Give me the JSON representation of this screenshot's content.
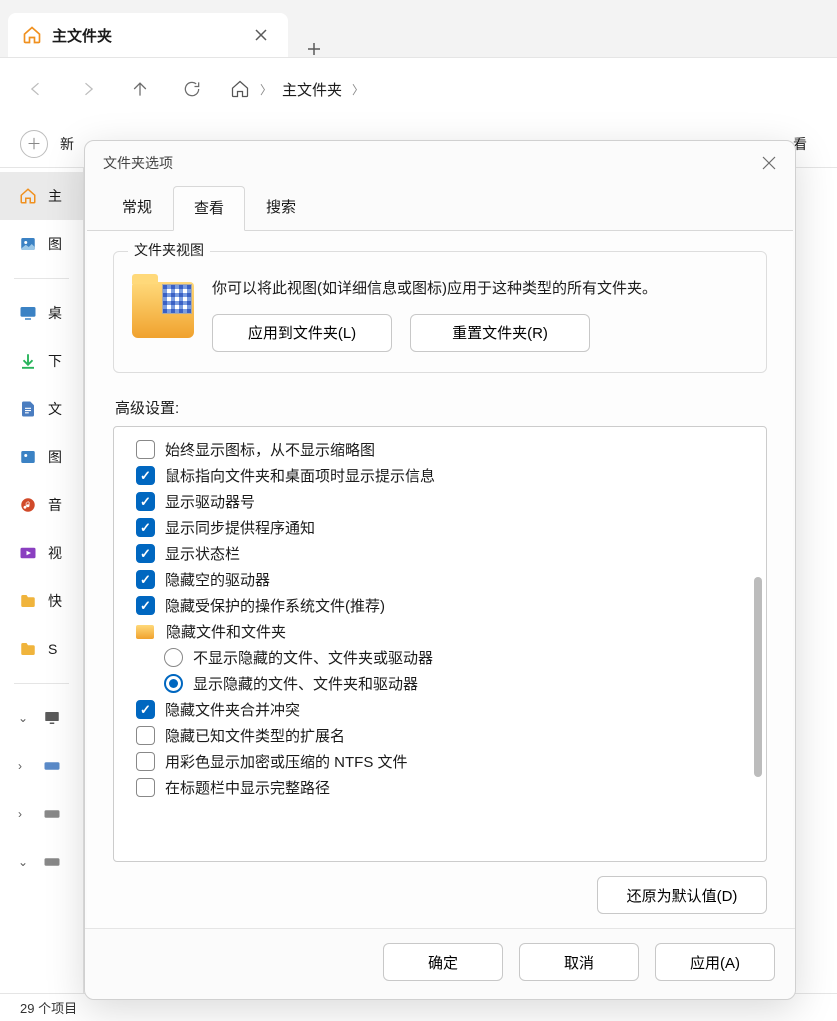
{
  "tab": {
    "title": "主文件夹"
  },
  "newButtonLabel": "新",
  "viewLabel": "看",
  "breadcrumb": {
    "item": "主文件夹"
  },
  "sidebar": {
    "items": [
      {
        "name": "home",
        "label": "主"
      },
      {
        "name": "images",
        "label": "图"
      },
      {
        "name": "desktop",
        "label": "桌"
      },
      {
        "name": "downloads",
        "label": "下"
      },
      {
        "name": "documents",
        "label": "文"
      },
      {
        "name": "pictures",
        "label": "图"
      },
      {
        "name": "music",
        "label": "音"
      },
      {
        "name": "videos",
        "label": "视"
      },
      {
        "name": "shortcut1",
        "label": "快"
      },
      {
        "name": "shortcut2",
        "label": "S"
      }
    ]
  },
  "statusbar": "29 个项目",
  "dialog": {
    "title": "文件夹选项",
    "tabs": {
      "general": "常规",
      "view": "查看",
      "search": "搜索"
    },
    "group": {
      "legend": "文件夹视图",
      "text": "你可以将此视图(如详细信息或图标)应用于这种类型的所有文件夹。",
      "applyBtn": "应用到文件夹(L)",
      "resetBtn": "重置文件夹(R)"
    },
    "advLabel": "高级设置:",
    "options": [
      {
        "type": "check",
        "checked": false,
        "label": "始终显示图标，从不显示缩略图"
      },
      {
        "type": "check",
        "checked": true,
        "label": "鼠标指向文件夹和桌面项时显示提示信息"
      },
      {
        "type": "check",
        "checked": true,
        "label": "显示驱动器号"
      },
      {
        "type": "check",
        "checked": true,
        "label": "显示同步提供程序通知"
      },
      {
        "type": "check",
        "checked": true,
        "label": "显示状态栏"
      },
      {
        "type": "check",
        "checked": true,
        "label": "隐藏空的驱动器"
      },
      {
        "type": "check",
        "checked": true,
        "label": "隐藏受保护的操作系统文件(推荐)"
      },
      {
        "type": "folder",
        "label": "隐藏文件和文件夹"
      },
      {
        "type": "radio",
        "checked": false,
        "indent": true,
        "label": "不显示隐藏的文件、文件夹或驱动器"
      },
      {
        "type": "radio",
        "checked": true,
        "indent": true,
        "label": "显示隐藏的文件、文件夹和驱动器"
      },
      {
        "type": "check",
        "checked": true,
        "label": "隐藏文件夹合并冲突"
      },
      {
        "type": "check",
        "checked": false,
        "label": "隐藏已知文件类型的扩展名"
      },
      {
        "type": "check",
        "checked": false,
        "label": "用彩色显示加密或压缩的 NTFS 文件"
      },
      {
        "type": "check",
        "checked": false,
        "label": "在标题栏中显示完整路径"
      }
    ],
    "resetDefaults": "还原为默认值(D)",
    "footer": {
      "ok": "确定",
      "cancel": "取消",
      "apply": "应用(A)"
    }
  }
}
